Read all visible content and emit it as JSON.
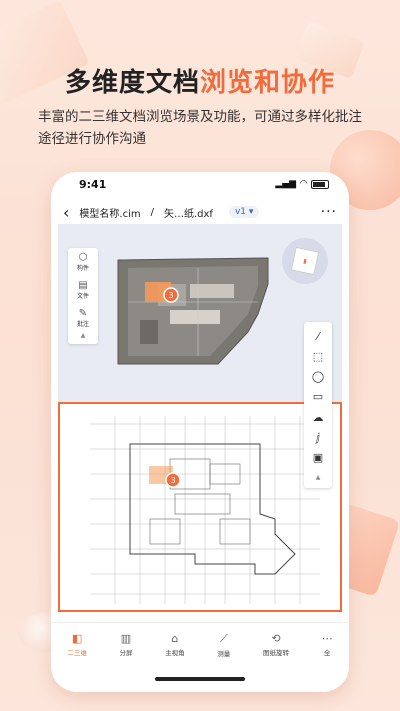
{
  "headline": {
    "dark": "多维度文档",
    "orange": "浏览和协作"
  },
  "subline": "丰富的二三维文档浏览场景及功能，可通过多样化批注途径进行协作沟通",
  "status": {
    "time": "9:41"
  },
  "nav": {
    "back_icon": "chevron-left-icon",
    "model": "模型名称.cim",
    "separator": "/",
    "file": "矢…纸.dxf",
    "version": "v1 ▾",
    "more": "···"
  },
  "side_panel": [
    {
      "icon": "cube-icon",
      "label": "构件"
    },
    {
      "icon": "file-icon",
      "label": "文件"
    },
    {
      "icon": "annotate-icon",
      "label": "批注"
    }
  ],
  "markers": {
    "top": "3",
    "bottom": "3"
  },
  "tools": [
    "line-tool",
    "rect-dashed-tool",
    "ellipse-tool",
    "rect-tool",
    "cloud-tool",
    "text-tool",
    "stamp-tool"
  ],
  "tabs": [
    {
      "label": "二三维",
      "icon": "2d3d-icon",
      "active": true
    },
    {
      "label": "分屏",
      "icon": "split-icon",
      "active": false
    },
    {
      "label": "主视角",
      "icon": "home-view-icon",
      "active": false
    },
    {
      "label": "测量",
      "icon": "measure-icon",
      "active": false
    },
    {
      "label": "图纸旋转",
      "icon": "rotate-icon",
      "active": false
    },
    {
      "label": "全",
      "icon": "more-icon",
      "active": false
    }
  ],
  "colors": {
    "accent": "#f26b3a",
    "bg": "#fbe0d3"
  }
}
